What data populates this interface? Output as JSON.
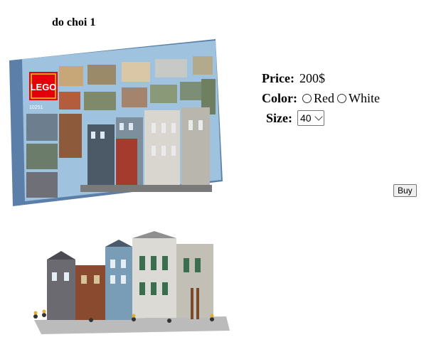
{
  "product": {
    "title": "do choi 1",
    "price_label": "Price:",
    "price_value": "200$",
    "color_label": "Color:",
    "color_options": [
      "Red",
      "White"
    ],
    "size_label": "Size:",
    "size_selected": "40",
    "buy_label": "Buy"
  },
  "box_image": {
    "brand": "LEGO",
    "set_number": "10251"
  }
}
